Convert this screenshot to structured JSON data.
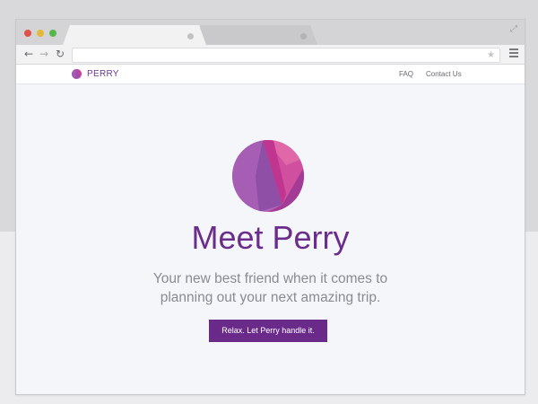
{
  "browser": {
    "tabs": [
      {
        "label": "",
        "active": true
      },
      {
        "label": "",
        "active": false
      }
    ],
    "address": {
      "value": "",
      "placeholder": ""
    },
    "icons": {
      "back": "back-arrow-icon",
      "forward": "forward-arrow-icon",
      "reload": "reload-icon",
      "bookmark": "star-icon",
      "menu": "hamburger-menu-icon",
      "fullscreen": "expand-icon"
    }
  },
  "site": {
    "brand": "PERRY",
    "nav": [
      {
        "label": "FAQ"
      },
      {
        "label": "Contact Us"
      }
    ]
  },
  "hero": {
    "title": "Meet Perry",
    "subtitle_line1": "Your new best friend when it comes to",
    "subtitle_line2": "planning out your next amazing trip.",
    "cta_label": "Relax. Let Perry handle it."
  },
  "colors": {
    "brand_purple": "#6b2d8c",
    "button_purple": "#6a2a8a",
    "logo_magenta": "#c2409a",
    "page_background": "#f4f6fa"
  }
}
